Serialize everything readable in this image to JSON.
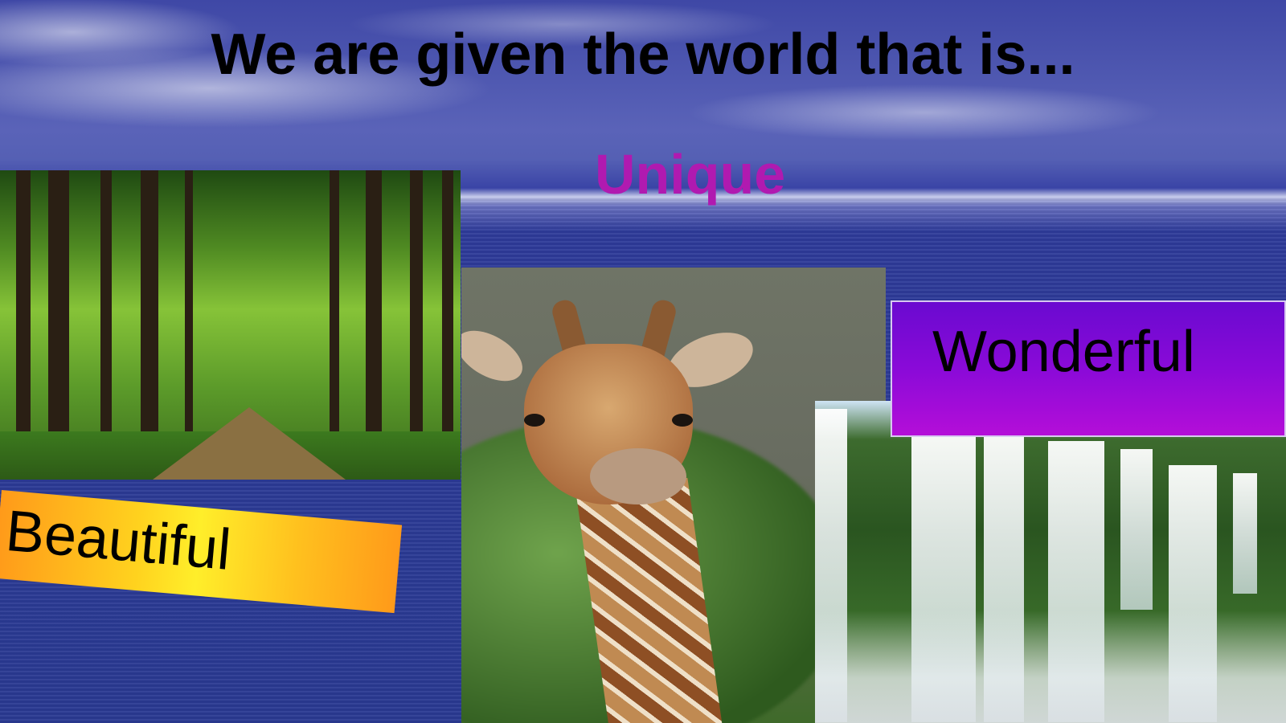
{
  "slide": {
    "title": "We are given the world that is...",
    "words": {
      "unique": "Unique",
      "beautiful": "Beautiful",
      "wonderful": "Wonderful"
    }
  },
  "colors": {
    "title": "#000000",
    "unique": "#b01ab0",
    "beautiful_banner": "#ffd21e",
    "wonderful_box": "#8a0ad8"
  },
  "images": [
    "forest-road-photo",
    "giraffe-photo",
    "waterfall-photo",
    "sky-sea-background"
  ]
}
